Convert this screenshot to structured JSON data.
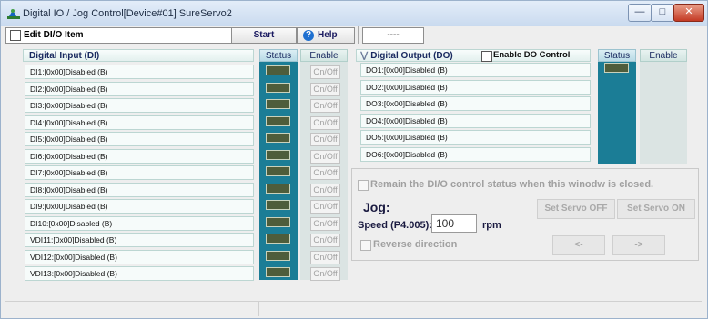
{
  "window": {
    "title": "Digital IO / Jog Control[Device#01] SureServo2",
    "controls": [
      "minimize-icon",
      "maximize-icon",
      "close-icon"
    ]
  },
  "toolbar": {
    "edit_label": "Edit DI/O Item",
    "start_label": "Start",
    "help_label": "Help",
    "status_text": "----"
  },
  "di": {
    "header": "Digital Input (DI)",
    "status_header": "Status",
    "enable_header": "Enable",
    "onoff_label": "On/Off",
    "items": [
      "DI1:[0x00]Disabled (B)",
      "DI2:[0x00]Disabled (B)",
      "DI3:[0x00]Disabled (B)",
      "DI4:[0x00]Disabled (B)",
      "DI5:[0x00]Disabled (B)",
      "DI6:[0x00]Disabled (B)",
      "DI7:[0x00]Disabled (B)",
      "DI8:[0x00]Disabled (B)",
      "DI9:[0x00]Disabled (B)",
      "DI10:[0x00]Disabled (B)",
      "VDI11:[0x00]Disabled (B)",
      "VDI12:[0x00]Disabled (B)",
      "VDI13:[0x00]Disabled (B)"
    ]
  },
  "do": {
    "header": "Digital Output (DO)",
    "enable_control_label": "Enable DO Control",
    "status_header": "Status",
    "enable_header": "Enable",
    "items": [
      "DO1:[0x00]Disabled (B)",
      "DO2:[0x00]Disabled (B)",
      "DO3:[0x00]Disabled (B)",
      "DO4:[0x00]Disabled (B)",
      "DO5:[0x00]Disabled (B)",
      "DO6:[0x00]Disabled (B)"
    ]
  },
  "jog": {
    "remain_label": "Remain the DI/O control status when this winodw is closed.",
    "title": "Jog:",
    "speed_label": "Speed (P4.005):",
    "speed_value": "100",
    "speed_unit": "rpm",
    "reverse_label": "Reverse direction",
    "set_servo_off": "Set Servo OFF",
    "set_servo_on": "Set Servo ON",
    "left_arrow": "<-",
    "right_arrow": "->"
  },
  "colors": {
    "status_column": "#1b7d96",
    "led_off": "#4e5d3b",
    "header_text": "#1a2a60"
  }
}
